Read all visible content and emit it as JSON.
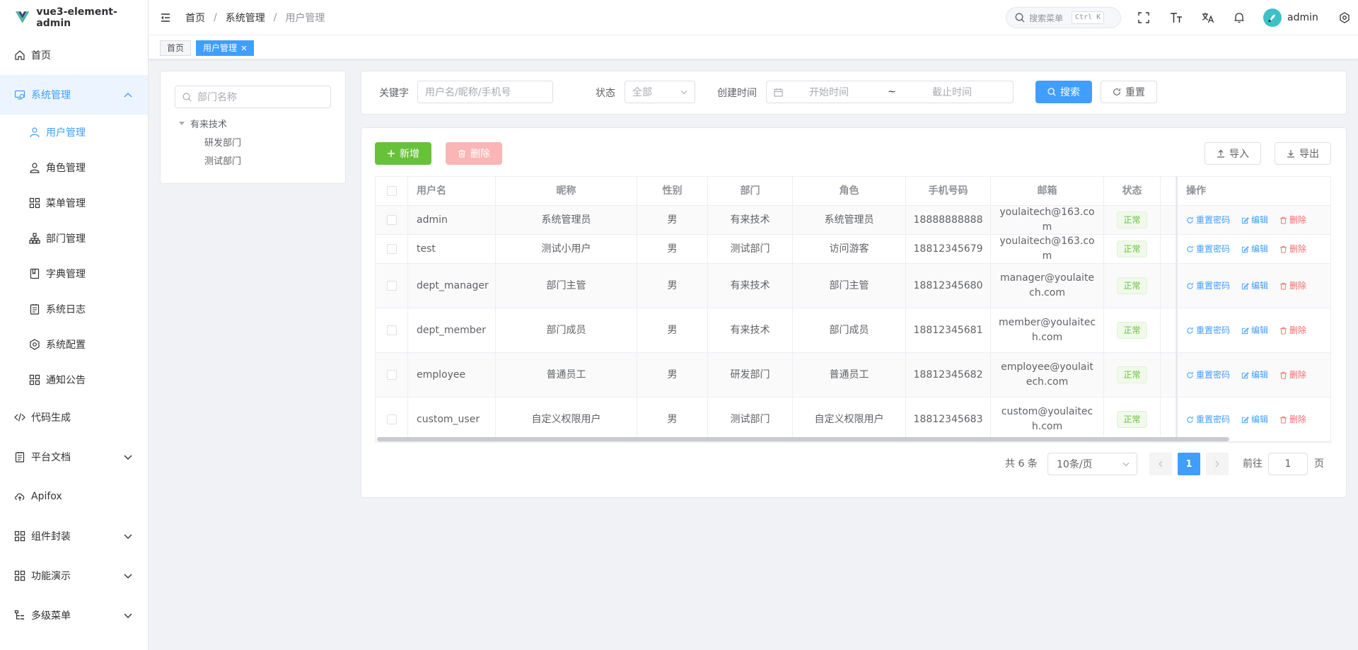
{
  "app": {
    "title": "vue3-element-admin"
  },
  "sidebar": {
    "items": [
      {
        "label": "首页"
      },
      {
        "label": "系统管理"
      },
      {
        "label": "代码生成"
      },
      {
        "label": "平台文档"
      },
      {
        "label": "Apifox"
      },
      {
        "label": "组件封装"
      },
      {
        "label": "功能演示"
      },
      {
        "label": "多级菜单"
      }
    ],
    "sub": [
      {
        "label": "用户管理"
      },
      {
        "label": "角色管理"
      },
      {
        "label": "菜单管理"
      },
      {
        "label": "部门管理"
      },
      {
        "label": "字典管理"
      },
      {
        "label": "系统日志"
      },
      {
        "label": "系统配置"
      },
      {
        "label": "通知公告"
      }
    ]
  },
  "header": {
    "breadcrumb": [
      "首页",
      "系统管理",
      "用户管理"
    ],
    "breadcrumb_sep": "/",
    "search_placeholder": "搜索菜单",
    "search_shortcut": "Ctrl K",
    "user": "admin"
  },
  "tags": {
    "home": "首页",
    "active": "用户管理"
  },
  "dept": {
    "search_placeholder": "部门名称",
    "root": "有来技术",
    "children": [
      "研发部门",
      "测试部门"
    ]
  },
  "filters": {
    "keyword_label": "关键字",
    "keyword_placeholder": "用户名/昵称/手机号",
    "status_label": "状态",
    "status_value": "全部",
    "time_label": "创建时间",
    "start_placeholder": "开始时间",
    "range_sep": "~",
    "end_placeholder": "截止时间",
    "search_btn": "搜索",
    "reset_btn": "重置"
  },
  "toolbar": {
    "add": "新增",
    "delete": "删除",
    "import": "导入",
    "export": "导出"
  },
  "table": {
    "headers": {
      "username": "用户名",
      "nickname": "昵称",
      "gender": "性别",
      "dept": "部门",
      "role": "角色",
      "phone": "手机号码",
      "email": "邮箱",
      "status": "状态",
      "ops": "操作"
    },
    "rows": [
      {
        "username": "admin",
        "nickname": "系统管理员",
        "gender": "男",
        "dept": "有来技术",
        "role": "系统管理员",
        "phone": "18888888888",
        "email": "youlaitech@163.com",
        "status": "正常"
      },
      {
        "username": "test",
        "nickname": "测试小用户",
        "gender": "男",
        "dept": "测试部门",
        "role": "访问游客",
        "phone": "18812345679",
        "email": "youlaitech@163.com",
        "status": "正常"
      },
      {
        "username": "dept_manager",
        "nickname": "部门主管",
        "gender": "男",
        "dept": "有来技术",
        "role": "部门主管",
        "phone": "18812345680",
        "email": "manager@youlaitech.com",
        "status": "正常"
      },
      {
        "username": "dept_member",
        "nickname": "部门成员",
        "gender": "男",
        "dept": "有来技术",
        "role": "部门成员",
        "phone": "18812345681",
        "email": "member@youlaitech.com",
        "status": "正常"
      },
      {
        "username": "employee",
        "nickname": "普通员工",
        "gender": "男",
        "dept": "研发部门",
        "role": "普通员工",
        "phone": "18812345682",
        "email": "employee@youlaitech.com",
        "status": "正常"
      },
      {
        "username": "custom_user",
        "nickname": "自定义权限用户",
        "gender": "男",
        "dept": "测试部门",
        "role": "自定义权限用户",
        "phone": "18812345683",
        "email": "custom@youlaitech.com",
        "status": "正常"
      }
    ],
    "ops": {
      "reset_pwd": "重置密码",
      "edit": "编辑",
      "delete": "删除"
    }
  },
  "pagination": {
    "total": "共 6 条",
    "page_size": "10条/页",
    "current": "1",
    "goto_label": "前往",
    "goto_value": "1",
    "page_unit": "页"
  },
  "colors": {
    "primary": "#409eff",
    "success": "#67c23a",
    "danger": "#f56c6c"
  }
}
